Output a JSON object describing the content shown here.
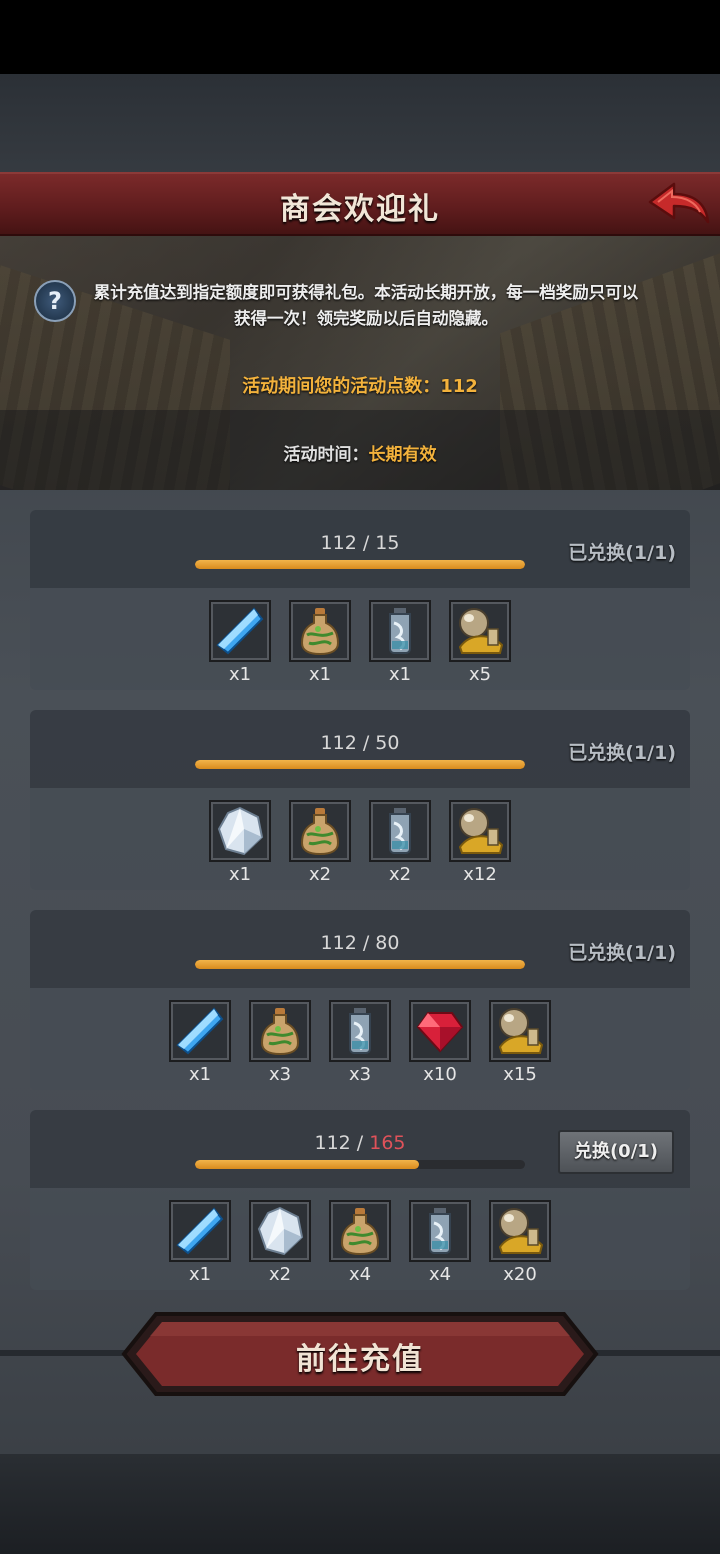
{
  "header": {
    "title": "商会欢迎礼"
  },
  "banner": {
    "description": "累计充值达到指定额度即可获得礼包。本活动长期开放，每一档奖励只可以获得一次！领完奖励以后自动隐藏。",
    "points_label": "活动期间您的活动点数：",
    "points_value": "112",
    "time_label": "活动时间：",
    "time_value": "长期有效"
  },
  "tiers": [
    {
      "current": "112",
      "sep": " / ",
      "required": "15",
      "progress": 1.0,
      "status": "已兑换(1/1)",
      "items": [
        {
          "icon": "blue-crystal-icon",
          "qty": "x1"
        },
        {
          "icon": "green-potion-icon",
          "qty": "x1"
        },
        {
          "icon": "water-vial-icon",
          "qty": "x1"
        },
        {
          "icon": "gold-pouch-icon",
          "qty": "x5"
        }
      ]
    },
    {
      "current": "112",
      "sep": " / ",
      "required": "50",
      "progress": 1.0,
      "status": "已兑换(1/1)",
      "items": [
        {
          "icon": "white-crystal-icon",
          "qty": "x1"
        },
        {
          "icon": "green-potion-icon",
          "qty": "x2"
        },
        {
          "icon": "water-vial-icon",
          "qty": "x2"
        },
        {
          "icon": "gold-pouch-icon",
          "qty": "x12"
        }
      ]
    },
    {
      "current": "112",
      "sep": " / ",
      "required": "80",
      "progress": 1.0,
      "status": "已兑换(1/1)",
      "items": [
        {
          "icon": "blue-crystal-icon",
          "qty": "x1"
        },
        {
          "icon": "green-potion-icon",
          "qty": "x3"
        },
        {
          "icon": "water-vial-icon",
          "qty": "x3"
        },
        {
          "icon": "ruby-icon",
          "qty": "x10"
        },
        {
          "icon": "gold-pouch-icon",
          "qty": "x15"
        }
      ]
    },
    {
      "current": "112",
      "sep": " / ",
      "required": "165",
      "progress": 0.679,
      "button": "兑换(0/1)",
      "items": [
        {
          "icon": "blue-crystal-icon",
          "qty": "x1"
        },
        {
          "icon": "white-crystal-icon",
          "qty": "x2"
        },
        {
          "icon": "green-potion-icon",
          "qty": "x4"
        },
        {
          "icon": "water-vial-icon",
          "qty": "x4"
        },
        {
          "icon": "gold-pouch-icon",
          "qty": "x20"
        }
      ]
    }
  ],
  "cta": {
    "label": "前往充值"
  },
  "colors": {
    "accent_gold": "#f3b23c",
    "header_red": "#6b2323",
    "need_red": "#e0525a"
  }
}
